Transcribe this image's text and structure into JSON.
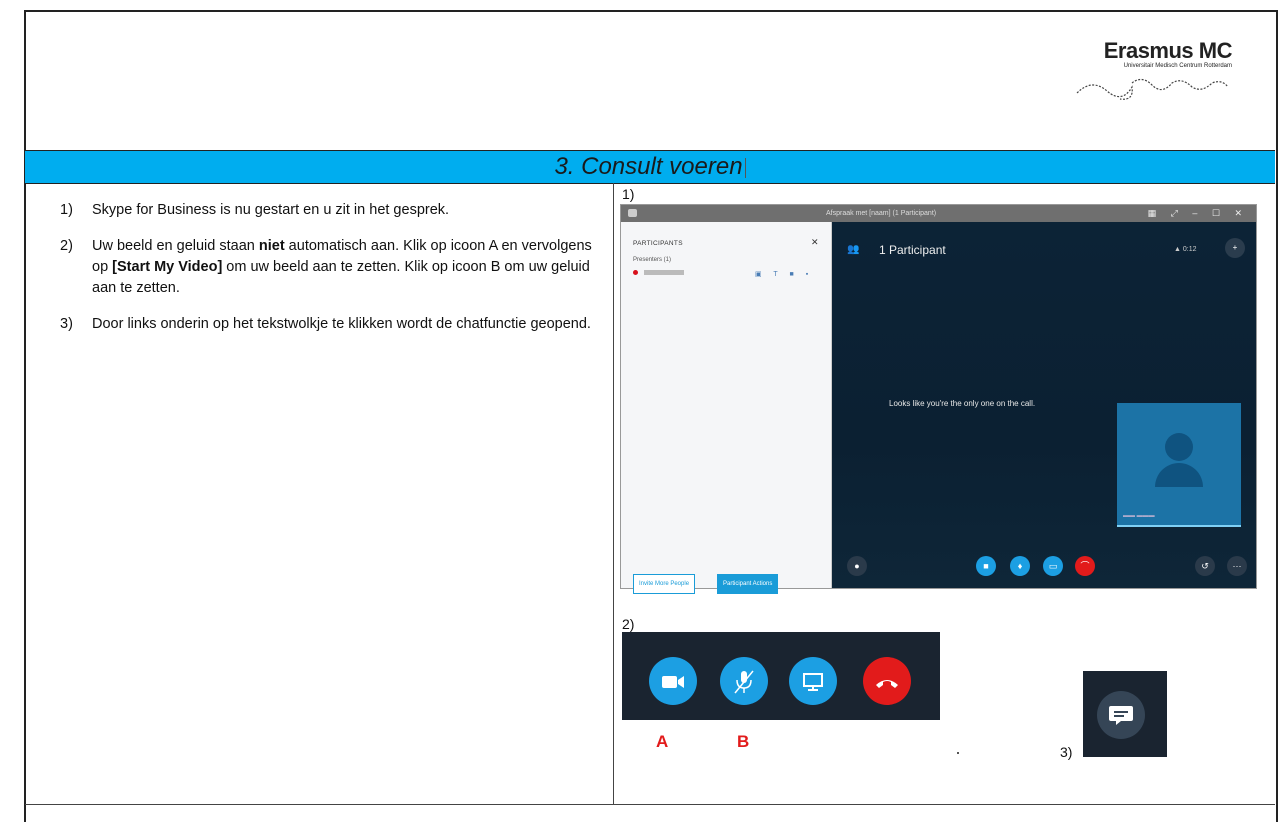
{
  "logo": {
    "title": "Erasmus MC",
    "subtitle": "Universitair Medisch Centrum Rotterdam"
  },
  "section_title": "3. Consult voeren",
  "steps": [
    {
      "num": "1)",
      "text": "Skype for Business is nu gestart en u zit in het gesprek."
    },
    {
      "num": "2)",
      "text_before": "Uw beeld en geluid staan ",
      "bold1": "niet",
      "text_mid": " automatisch aan. Klik op icoon A en vervolgens op ",
      "bold2": "[Start My Video]",
      "text_after": " om uw beeld aan te zetten. Klik op icoon B om uw geluid aan te zetten."
    },
    {
      "num": "3)",
      "text": "Door links onderin op het tekstwolkje te klikken wordt de chatfunctie geopend."
    }
  ],
  "figure_labels": {
    "fig1": "1)",
    "fig2": "2)",
    "fig3": "3)"
  },
  "skype": {
    "window_title": "Afspraak met [naam] (1 Participant)",
    "participants_header": "PARTICIPANTS",
    "presenters": "Presenters (1)",
    "participant_count": "1 Participant",
    "signal_time": "0:12",
    "alone_message": "Looks like you're the only one on the call.",
    "invite_button": "Invite More People",
    "actions_button": "Participant Actions"
  },
  "button_labels": {
    "a": "A",
    "b": "B"
  },
  "icons": [
    "chat-icon",
    "video-icon",
    "mic-icon",
    "screen-share-icon",
    "hang-up-icon",
    "more-icon",
    "participants-icon",
    "add-person-icon"
  ],
  "colors": {
    "title_bar": "#00adef",
    "skype_blue": "#1c9fe3",
    "hangup_red": "#e21b1b",
    "label_red": "#e21b1b"
  }
}
